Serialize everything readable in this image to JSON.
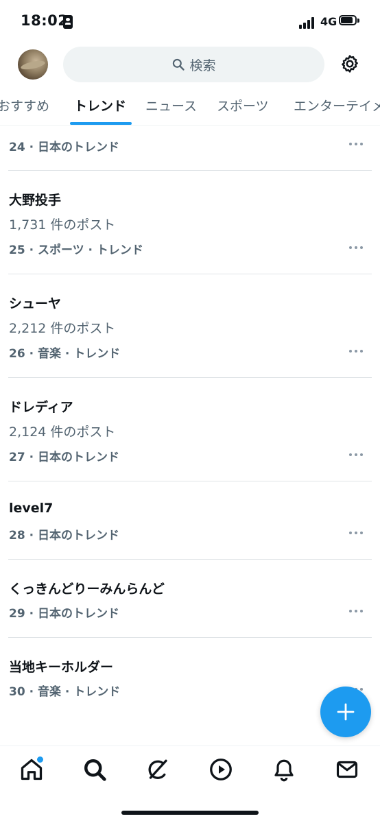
{
  "status_bar": {
    "time": "18:02",
    "network": "4G",
    "battery_level": 0.85
  },
  "header": {
    "search_placeholder": "検索",
    "icons": [
      "avatar",
      "search-icon",
      "gear-icon"
    ]
  },
  "tabs": [
    {
      "label": "おすすめ",
      "active": false
    },
    {
      "label": "トレンド",
      "active": true
    },
    {
      "label": "ニュース",
      "active": false
    },
    {
      "label": "スポーツ",
      "active": false
    },
    {
      "label": "エンターテイメント",
      "active": false
    }
  ],
  "trends": [
    {
      "meta": "24 · 日本のトレンド"
    },
    {
      "title": "大野投手",
      "count": "1,731 件のポスト",
      "meta": "25 · スポーツ · トレンド"
    },
    {
      "title": "シューヤ",
      "count": "2,212 件のポスト",
      "meta": "26 · 音楽 · トレンド"
    },
    {
      "title": "ドレディア",
      "count": "2,124 件のポスト",
      "meta": "27 · 日本のトレンド"
    },
    {
      "title": "level7",
      "meta": "28 · 日本のトレンド"
    },
    {
      "title": "くっきんどりーみんらんど",
      "meta": "29 · 日本のトレンド"
    },
    {
      "title": "当地キーホルダー",
      "meta": "30 · 音楽 · トレンド"
    }
  ],
  "bottom_nav": [
    "home-icon",
    "search-icon",
    "grok-icon",
    "video-icon",
    "bell-icon",
    "mail-icon"
  ],
  "colors": {
    "accent": "#1d9bf0",
    "text_primary": "#0f1419",
    "text_secondary": "#536471"
  }
}
